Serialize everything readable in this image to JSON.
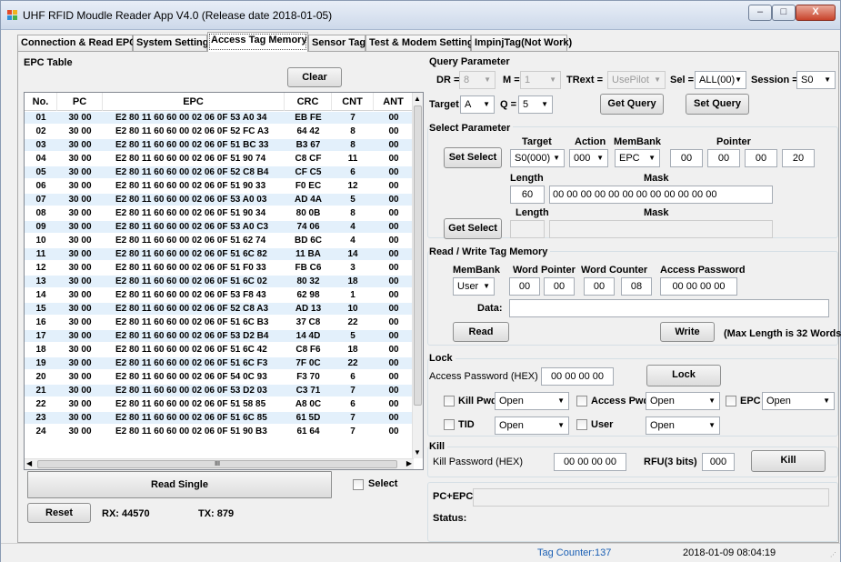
{
  "window": {
    "title": "UHF RFID Moudle Reader App V4.0 (Release date 2018-01-05)",
    "min": "–",
    "max": "□",
    "close": "X"
  },
  "tabs": [
    "Connection & Read EPC",
    "System Setting",
    "Access Tag Memory",
    "Sensor Tag",
    "Test & Modem Setting",
    "ImpinjTag(Not Work)"
  ],
  "epc_table": {
    "title": "EPC Table",
    "clear": "Clear",
    "headers": [
      "No.",
      "PC",
      "EPC",
      "CRC",
      "CNT",
      "ANT"
    ],
    "rows": [
      [
        "01",
        "30 00",
        "E2 80 11 60 60 00 02 06 0F 53 A0 34",
        "EB FE",
        "7",
        "00"
      ],
      [
        "02",
        "30 00",
        "E2 80 11 60 60 00 02 06 0F 52 FC A3",
        "64 42",
        "8",
        "00"
      ],
      [
        "03",
        "30 00",
        "E2 80 11 60 60 00 02 06 0F 51 BC 33",
        "B3 67",
        "8",
        "00"
      ],
      [
        "04",
        "30 00",
        "E2 80 11 60 60 00 02 06 0F 51 90 74",
        "C8 CF",
        "11",
        "00"
      ],
      [
        "05",
        "30 00",
        "E2 80 11 60 60 00 02 06 0F 52 C8 B4",
        "CF C5",
        "6",
        "00"
      ],
      [
        "06",
        "30 00",
        "E2 80 11 60 60 00 02 06 0F 51 90 33",
        "F0 EC",
        "12",
        "00"
      ],
      [
        "07",
        "30 00",
        "E2 80 11 60 60 00 02 06 0F 53 A0 03",
        "AD 4A",
        "5",
        "00"
      ],
      [
        "08",
        "30 00",
        "E2 80 11 60 60 00 02 06 0F 51 90 34",
        "80 0B",
        "8",
        "00"
      ],
      [
        "09",
        "30 00",
        "E2 80 11 60 60 00 02 06 0F 53 A0 C3",
        "74 06",
        "4",
        "00"
      ],
      [
        "10",
        "30 00",
        "E2 80 11 60 60 00 02 06 0F 51 62 74",
        "BD 6C",
        "4",
        "00"
      ],
      [
        "11",
        "30 00",
        "E2 80 11 60 60 00 02 06 0F 51 6C 82",
        "11 BA",
        "14",
        "00"
      ],
      [
        "12",
        "30 00",
        "E2 80 11 60 60 00 02 06 0F 51 F0 33",
        "FB C6",
        "3",
        "00"
      ],
      [
        "13",
        "30 00",
        "E2 80 11 60 60 00 02 06 0F 51 6C 02",
        "80 32",
        "18",
        "00"
      ],
      [
        "14",
        "30 00",
        "E2 80 11 60 60 00 02 06 0F 53 F8 43",
        "62 98",
        "1",
        "00"
      ],
      [
        "15",
        "30 00",
        "E2 80 11 60 60 00 02 06 0F 52 C8 A3",
        "AD 13",
        "10",
        "00"
      ],
      [
        "16",
        "30 00",
        "E2 80 11 60 60 00 02 06 0F 51 6C B3",
        "37 C8",
        "22",
        "00"
      ],
      [
        "17",
        "30 00",
        "E2 80 11 60 60 00 02 06 0F 53 D2 B4",
        "14 4D",
        "5",
        "00"
      ],
      [
        "18",
        "30 00",
        "E2 80 11 60 60 00 02 06 0F 51 6C 42",
        "C8 F6",
        "18",
        "00"
      ],
      [
        "19",
        "30 00",
        "E2 80 11 60 60 00 02 06 0F 51 6C F3",
        "7F 0C",
        "22",
        "00"
      ],
      [
        "20",
        "30 00",
        "E2 80 11 60 60 00 02 06 0F 54 0C 93",
        "F3 70",
        "6",
        "00"
      ],
      [
        "21",
        "30 00",
        "E2 80 11 60 60 00 02 06 0F 53 D2 03",
        "C3 71",
        "7",
        "00"
      ],
      [
        "22",
        "30 00",
        "E2 80 11 60 60 00 02 06 0F 51 58 85",
        "A8 0C",
        "6",
        "00"
      ],
      [
        "23",
        "30 00",
        "E2 80 11 60 60 00 02 06 0F 51 6C 85",
        "61 5D",
        "7",
        "00"
      ],
      [
        "24",
        "30 00",
        "E2 80 11 60 60 00 02 06 0F 51 90 B3",
        "61 64",
        "7",
        "00"
      ]
    ],
    "hscroll_grip": "III"
  },
  "bottom_left": {
    "read_single": "Read Single",
    "select": "Select",
    "reset": "Reset",
    "rx": "RX:  44570",
    "tx": "TX:  879"
  },
  "query": {
    "title": "Query Parameter",
    "dr_label": "DR =",
    "dr": "8",
    "m_label": "M =",
    "m": "1",
    "trext_label": "TRext =",
    "trext": "UsePilot",
    "sel_label": "Sel =",
    "sel": "ALL(00)",
    "session_label": "Session =",
    "session": "S0",
    "target_label": "Target =",
    "target": "A",
    "q_label": "Q =",
    "q": "5",
    "get_query": "Get Query",
    "set_query": "Set Query"
  },
  "select": {
    "title": "Select Parameter",
    "set_select": "Set Select",
    "get_select": "Get Select",
    "target_label": "Target",
    "action_label": "Action",
    "membank_label": "MemBank",
    "pointer_label": "Pointer",
    "target": "S0(000)",
    "action": "000",
    "membank": "EPC",
    "pointer": [
      "00",
      "00",
      "00",
      "20"
    ],
    "length_label": "Length",
    "mask_label": "Mask",
    "length": "60",
    "mask": "00 00 00 00 00 00 00 00 00 00 00 00",
    "length_label2": "Length",
    "mask_label2": "Mask"
  },
  "rw": {
    "title": "Read / Write Tag Memory",
    "membank_label": "MemBank",
    "word_pointer_label": "Word Pointer",
    "word_counter_label": "Word Counter",
    "access_password_label": "Access Password",
    "membank": "User",
    "word_pointer": [
      "00",
      "00"
    ],
    "word_counter": [
      "00",
      "08"
    ],
    "access_password": "00 00 00 00",
    "data_label": "Data:",
    "data": "",
    "read": "Read",
    "write": "Write",
    "max_note": "(Max Length is 32 Words)"
  },
  "lock": {
    "title": "Lock",
    "access_password_label": "Access Password (HEX)",
    "access_password": "00 00 00 00",
    "lock_button": "Lock",
    "kill_pwd": "Kill Pwd",
    "kill_pwd_val": "Open",
    "access_pwd": "Access Pwd",
    "access_pwd_val": "Open",
    "epc": "EPC",
    "epc_val": "Open",
    "tid": "TID",
    "tid_val": "Open",
    "user": "User",
    "user_val": "Open"
  },
  "kill": {
    "title": "Kill",
    "password_label": "Kill Password (HEX)",
    "password": "00 00 00 00",
    "rfu_label": "RFU(3 bits)",
    "rfu": "000",
    "kill_button": "Kill"
  },
  "pcepc": {
    "label": "PC+EPC:",
    "value": "",
    "status_label": "Status:",
    "status": ""
  },
  "statusbar": {
    "tag_counter": "Tag Counter:137",
    "datetime": "2018-01-09 08:04:19"
  },
  "colors": {
    "row_alt": "#e3f0fb",
    "tag_counter": "#1a5fb4"
  }
}
